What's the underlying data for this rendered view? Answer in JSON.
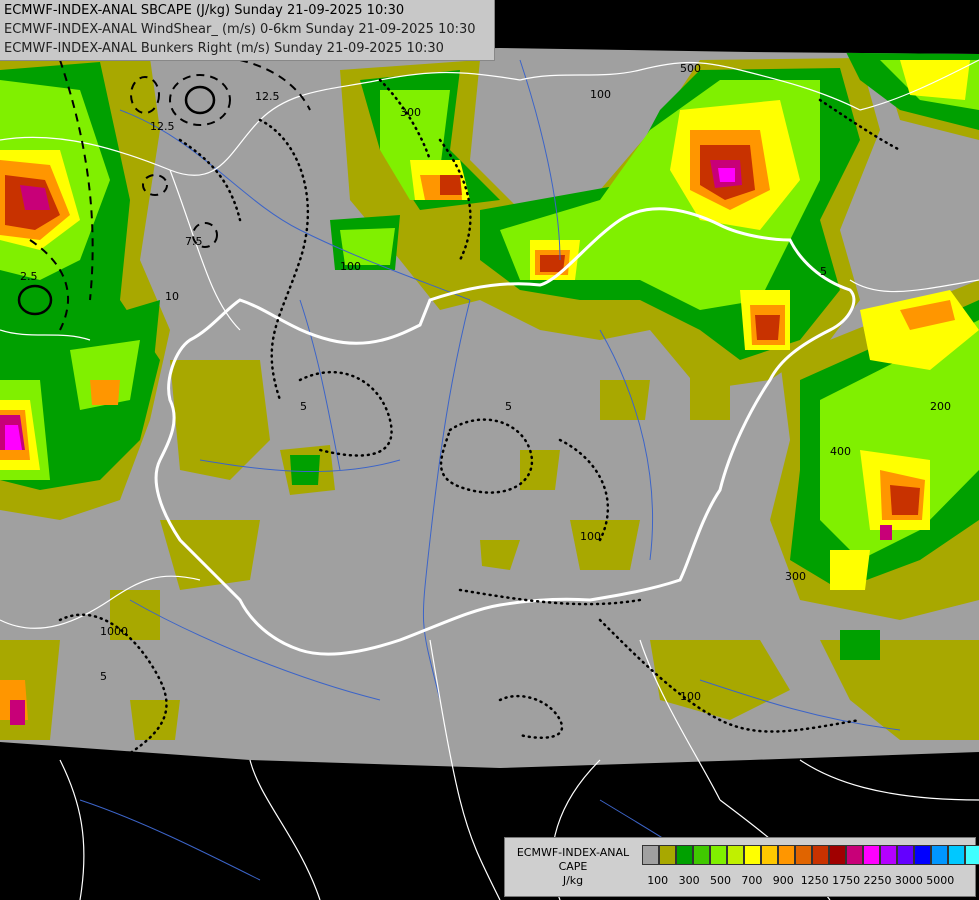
{
  "header": {
    "line1": "ECMWF-INDEX-ANAL SBCAPE (J/kg) Sunday 21-09-2025 10:30",
    "line2": "ECMWF-INDEX-ANAL WindShear_ (m/s) 0-6km Sunday 21-09-2025 10:30",
    "line3": "ECMWF-INDEX-ANAL Bunkers Right (m/s) Sunday 21-09-2025 10:30"
  },
  "legend": {
    "title_line1": "ECMWF-INDEX-ANAL",
    "title_line2": "CAPE",
    "title_line3": "J/kg",
    "colors": [
      "#a0a0a0",
      "#a8a800",
      "#00a000",
      "#40c800",
      "#80f000",
      "#c0f000",
      "#ffff00",
      "#ffc800",
      "#ff9600",
      "#e06400",
      "#c83200",
      "#a00000",
      "#c80078",
      "#ff00ff",
      "#b400ff",
      "#6400ff",
      "#0000ff",
      "#0096ff",
      "#00c8ff",
      "#40ffff",
      "#ffffff"
    ],
    "ticks": [
      "100",
      "300",
      "500",
      "700",
      "900",
      "1250",
      "1750",
      "2250",
      "3000",
      "5000"
    ]
  },
  "map_labels": {
    "cape_values": [
      "100",
      "300",
      "500",
      "200",
      "400",
      "1000"
    ],
    "shear_values": [
      "12.5",
      "10",
      "5",
      "7.5",
      "2.5"
    ]
  }
}
